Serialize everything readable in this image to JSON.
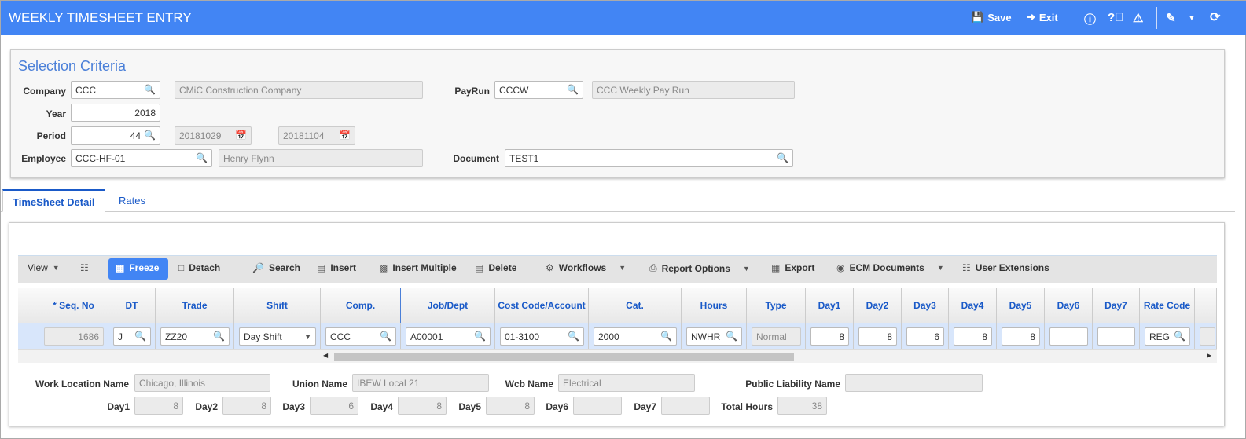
{
  "header": {
    "title": "WEEKLY TIMESHEET ENTRY",
    "save": "Save",
    "exit": "Exit"
  },
  "selection": {
    "title": "Selection Criteria",
    "company_label": "Company",
    "company": "CCC",
    "company_name": "CMiC Construction Company",
    "payrun_label": "PayRun",
    "payrun": "CCCW",
    "payrun_name": "CCC Weekly Pay Run",
    "year_label": "Year",
    "year": "2018",
    "period_label": "Period",
    "period": "44",
    "period_start": "20181029",
    "period_end": "20181104",
    "employee_label": "Employee",
    "employee": "CCC-HF-01",
    "employee_name": "Henry Flynn",
    "document_label": "Document",
    "document": "TEST1"
  },
  "tabs": [
    "TimeSheet Detail",
    "Rates"
  ],
  "toolbar": {
    "view": "View",
    "freeze": "Freeze",
    "detach": "Detach",
    "search": "Search",
    "insert": "Insert",
    "insert_multiple": "Insert Multiple",
    "delete": "Delete",
    "workflows": "Workflows",
    "report_options": "Report Options",
    "export": "Export",
    "ecm": "ECM Documents",
    "user_ext": "User Extensions"
  },
  "columns": [
    "* Seq. No",
    "DT",
    "Trade",
    "Shift",
    "Comp.",
    "Job/Dept",
    "Cost Code/Account",
    "Cat.",
    "Hours",
    "Type",
    "Day1",
    "Day2",
    "Day3",
    "Day4",
    "Day5",
    "Day6",
    "Day7",
    "Rate Code"
  ],
  "row": [
    "1686",
    "J",
    "ZZ20",
    "Day Shift",
    "CCC",
    "A00001",
    "01-3100",
    "2000",
    "NWHR",
    "Normal",
    "8",
    "8",
    "6",
    "8",
    "8",
    "",
    "",
    "REG"
  ],
  "details": {
    "work_location_label": "Work Location Name",
    "work_location": "Chicago, Illinois",
    "union_label": "Union Name",
    "union": "IBEW Local 21",
    "wcb_label": "Wcb Name",
    "wcb": "Electrical",
    "pl_label": "Public Liability Name",
    "pl": "",
    "days": [
      {
        "label": "Day1",
        "value": "8"
      },
      {
        "label": "Day2",
        "value": "8"
      },
      {
        "label": "Day3",
        "value": "6"
      },
      {
        "label": "Day4",
        "value": "8"
      },
      {
        "label": "Day5",
        "value": "8"
      },
      {
        "label": "Day6",
        "value": ""
      },
      {
        "label": "Day7",
        "value": ""
      }
    ],
    "total_label": "Total Hours",
    "total": "38"
  }
}
